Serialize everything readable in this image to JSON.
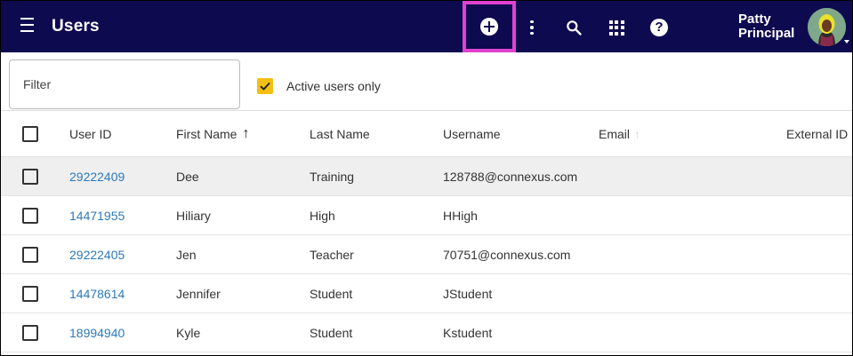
{
  "header": {
    "title": "Users",
    "user_name_line1": "Patty",
    "user_name_line2": "Principal",
    "help_glyph": "?",
    "icons": [
      "menu-icon",
      "add-circle-icon",
      "more-vert-icon",
      "search-icon",
      "apps-grid-icon",
      "help-icon",
      "avatar"
    ]
  },
  "filter": {
    "placeholder": "Filter",
    "active_only_label": "Active users only",
    "active_only_checked": true
  },
  "table": {
    "columns": [
      "User ID",
      "First Name",
      "Last Name",
      "Username",
      "Email",
      "External ID"
    ],
    "sorted_column": "First Name",
    "sort_direction": "ascending",
    "rows": [
      {
        "id": "29222409",
        "first": "Dee",
        "last": "Training",
        "username": "128788@connexus.com",
        "email": "",
        "external_id": "",
        "highlighted": true
      },
      {
        "id": "14471955",
        "first": "Hiliary",
        "last": "High",
        "username": "HHigh",
        "email": "",
        "external_id": ""
      },
      {
        "id": "29222405",
        "first": "Jen",
        "last": "Teacher",
        "username": "70751@connexus.com",
        "email": "",
        "external_id": ""
      },
      {
        "id": "14478614",
        "first": "Jennifer",
        "last": "Student",
        "username": "JStudent",
        "email": "",
        "external_id": ""
      },
      {
        "id": "18994940",
        "first": "Kyle",
        "last": "Student",
        "username": "Kstudent",
        "email": "",
        "external_id": ""
      }
    ]
  },
  "colors": {
    "appbar": "#0e0a50",
    "highlight_outline": "#e042d0",
    "checkbox_accent": "#f3c012",
    "link": "#2d7ab8"
  }
}
